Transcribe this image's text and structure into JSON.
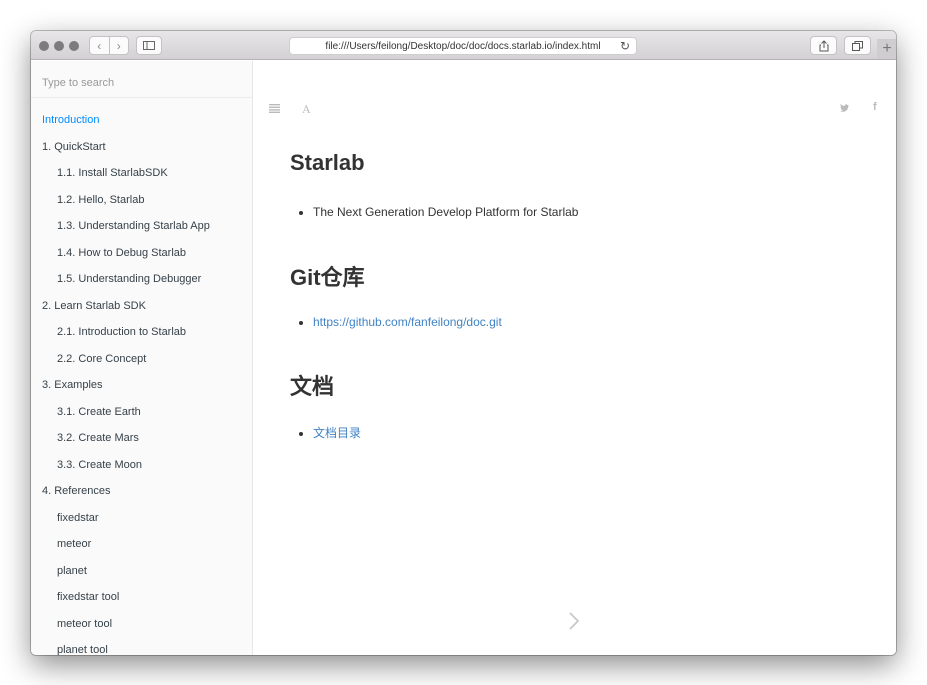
{
  "browser": {
    "url": "file:///Users/feilong/Desktop/doc/doc/docs.starlab.io/index.html"
  },
  "sidebar": {
    "search_placeholder": "Type to search",
    "items": [
      {
        "label": "Introduction",
        "active": true,
        "level": 0
      },
      {
        "label": "1. QuickStart",
        "level": 0
      },
      {
        "label": "1.1. Install StarlabSDK",
        "level": 1
      },
      {
        "label": "1.2. Hello, Starlab",
        "level": 1
      },
      {
        "label": "1.3. Understanding Starlab App",
        "level": 1
      },
      {
        "label": "1.4. How to Debug Starlab",
        "level": 1
      },
      {
        "label": "1.5. Understanding Debugger",
        "level": 1
      },
      {
        "label": "2. Learn Starlab SDK",
        "level": 0
      },
      {
        "label": "2.1. Introduction to Starlab",
        "level": 1
      },
      {
        "label": "2.2. Core Concept",
        "level": 1
      },
      {
        "label": "3. Examples",
        "level": 0
      },
      {
        "label": "3.1. Create Earth",
        "level": 1
      },
      {
        "label": "3.2. Create Mars",
        "level": 1
      },
      {
        "label": "3.3. Create Moon",
        "level": 1
      },
      {
        "label": "4. References",
        "level": 0
      },
      {
        "label": "fixedstar",
        "level": 1
      },
      {
        "label": "meteor",
        "level": 1
      },
      {
        "label": "planet",
        "level": 1
      },
      {
        "label": "fixedstar tool",
        "level": 1
      },
      {
        "label": "meteor tool",
        "level": 1
      },
      {
        "label": "planet tool",
        "level": 1
      }
    ]
  },
  "toolbar": {
    "font_label": "A"
  },
  "article": {
    "h1_starlab": "Starlab",
    "starlab_item": "The Next Generation Develop Platform for Starlab",
    "h1_git": "Git仓库",
    "git_link": "https://github.com/fanfeilong/doc.git",
    "h1_docs": "文档",
    "docs_link": "文档目录"
  },
  "colors": {
    "accent": "#008cff",
    "link": "#4183c4"
  }
}
